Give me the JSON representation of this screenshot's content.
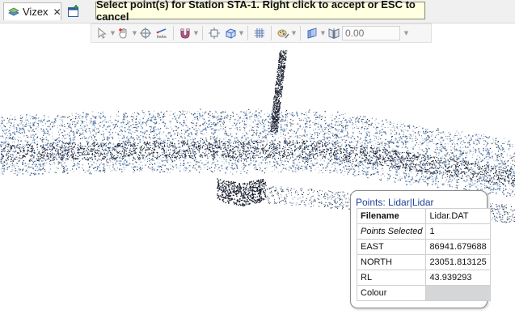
{
  "tab": {
    "label": "Vizex",
    "close": "✕"
  },
  "prompt": "Select point(s) for Station STA-1. Right click to accept or ESC to cancel",
  "toolbar": {
    "tools": [
      "select-arrow",
      "pan-hand",
      "crosshair",
      "measure",
      "magnet",
      "frame-box",
      "cube",
      "grid",
      "layers-brush",
      "planes",
      "section-view"
    ],
    "value_placeholder": "0.00"
  },
  "popup": {
    "title": "Points: Lidar|Lidar",
    "rows": [
      {
        "key": "Filename",
        "value": "Lidar.DAT"
      },
      {
        "key": "Points Selected",
        "value": "1"
      },
      {
        "key": "EAST",
        "value": "86941.679688"
      },
      {
        "key": "NORTH",
        "value": "23051.813125"
      },
      {
        "key": "RL",
        "value": "43.939293"
      },
      {
        "key": "Colour",
        "value": ""
      }
    ],
    "colour_swatch": "#d4d6d8"
  },
  "colors": {
    "prompt_bg": "#ffffe1",
    "point_dark": "#1b2030",
    "point_blue": "#5b7fae",
    "point_light": "#9fb6d4"
  }
}
